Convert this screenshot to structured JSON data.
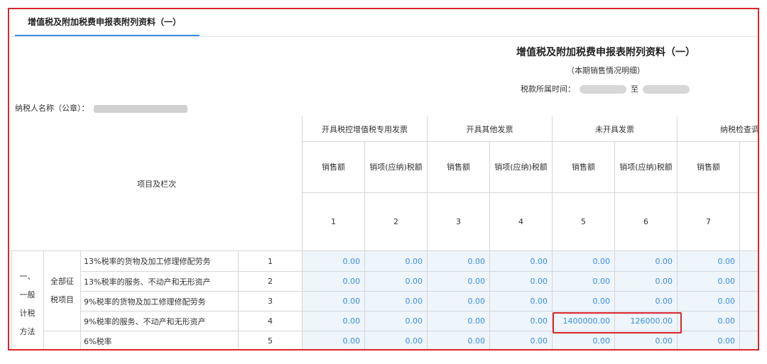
{
  "tab": {
    "label": "增值税及附加税费申报表附列资料（一）"
  },
  "report": {
    "title": "增值税及附加税费申报表附列资料（一）",
    "subtitle": "（本期销售情况明细）",
    "period_label": "税款所属时间：",
    "period_to": "至"
  },
  "taxpayer": {
    "label": "纳税人名称（公章）："
  },
  "table": {
    "item_header": "项目及栏次",
    "groups": [
      "开具税控增值税专用发票",
      "开具其他发票",
      "未开具发票",
      "纳税检查调"
    ],
    "subheaders": [
      "销售额",
      "销项(应纳)税额",
      "销售额",
      "销项(应纳)税额",
      "销售额",
      "销项(应纳)税额",
      "销售额",
      "销"
    ],
    "col_numbers": [
      "1",
      "2",
      "3",
      "4",
      "5",
      "6",
      "7"
    ],
    "section": "一、一般计税方法",
    "subsection": "全部征税项目",
    "rows": [
      {
        "label": "13%税率的货物及加工修理修配劳务",
        "no": "1",
        "values": [
          "0.00",
          "0.00",
          "0.00",
          "0.00",
          "0.00",
          "0.00",
          "0.00"
        ]
      },
      {
        "label": "13%税率的服务、不动产和无形资产",
        "no": "2",
        "values": [
          "0.00",
          "0.00",
          "0.00",
          "0.00",
          "0.00",
          "0.00",
          "0.00"
        ]
      },
      {
        "label": "9%税率的货物及加工修理修配劳务",
        "no": "3",
        "values": [
          "0.00",
          "0.00",
          "0.00",
          "0.00",
          "0.00",
          "0.00",
          "0.00"
        ]
      },
      {
        "label": "9%税率的服务、不动产和无形资产",
        "no": "4",
        "values": [
          "0.00",
          "0.00",
          "0.00",
          "0.00",
          "1400000.00",
          "126000.00",
          "0.00"
        ]
      },
      {
        "label": "6%税率",
        "no": "5",
        "values": [
          "0.00",
          "0.00",
          "0.00",
          "0.00",
          "0.00",
          "0.00",
          "0.00"
        ]
      }
    ]
  },
  "colors": {
    "highlight": "#d9262b",
    "value_text": "#3a8ee6",
    "value_bg": "#eef5fb",
    "tab_underline": "#3a8ee6"
  }
}
